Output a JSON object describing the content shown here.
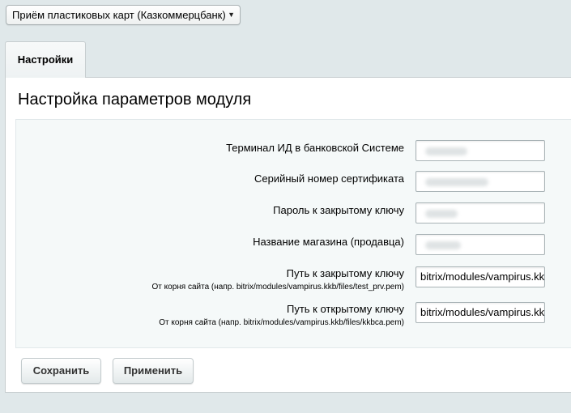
{
  "module_select": {
    "value": "Приём пластиковых карт (Казкоммерцбанк)"
  },
  "tabs": [
    {
      "label": "Настройки"
    }
  ],
  "panel": {
    "title": "Настройка параметров модуля"
  },
  "form": {
    "rows": [
      {
        "label": "Терминал ИД в банковской Системе",
        "hint": "",
        "value": ""
      },
      {
        "label": "Серийный номер сертификата",
        "hint": "",
        "value": ""
      },
      {
        "label": "Пароль к закрытому ключу",
        "hint": "",
        "value": ""
      },
      {
        "label": "Название магазина (продавца)",
        "hint": "",
        "value": ""
      },
      {
        "label": "Путь к закрытому ключу",
        "hint": "От корня сайта (напр. bitrix/modules/vampirus.kkb/files/test_prv.pem)",
        "value": "bitrix/modules/vampirus.kkb/files/test_prv.pem"
      },
      {
        "label": "Путь к открытому ключу",
        "hint": "От корня сайта (напр. bitrix/modules/vampirus.kkb/files/kkbca.pem)",
        "value": "bitrix/modules/vampirus.kkb/files/kkbca.pem"
      }
    ]
  },
  "buttons": {
    "save": "Сохранить",
    "apply": "Применить"
  }
}
